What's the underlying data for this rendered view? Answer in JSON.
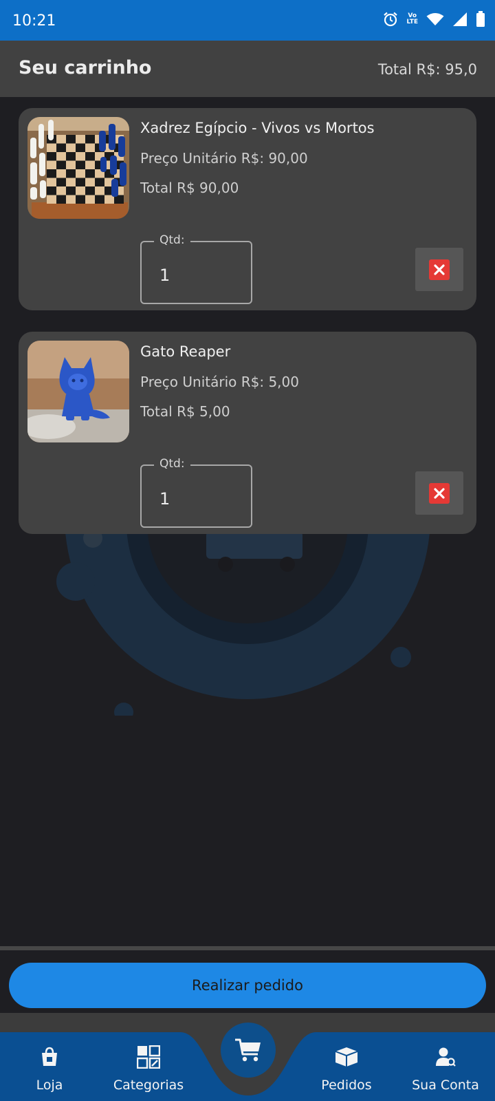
{
  "status_bar": {
    "time": "10:21",
    "network_label_top": "Vo",
    "network_label_bottom": "LTE"
  },
  "header": {
    "title": "Seu carrinho",
    "total": "Total R$: 95,0"
  },
  "cart": {
    "items": [
      {
        "name": "Xadrez Egípcio - Vivos vs Mortos",
        "unit_price": "Preço Unitário R$: 90,00",
        "total": "Total R$ 90,00",
        "qty_label": "Qtd:",
        "qty_value": "1",
        "image": "chess-set-photo"
      },
      {
        "name": "Gato Reaper",
        "unit_price": "Preço Unitário R$: 5,00",
        "total": "Total R$ 5,00",
        "qty_label": "Qtd:",
        "qty_value": "1",
        "image": "blue-cat-figurine-photo"
      }
    ]
  },
  "checkout": {
    "button_label": "Realizar pedido"
  },
  "bottom_nav": {
    "items": [
      {
        "label": "Loja",
        "icon": "store-bag-icon"
      },
      {
        "label": "Categorias",
        "icon": "categories-grid-icon"
      },
      {
        "label": "Pedidos",
        "icon": "package-icon"
      },
      {
        "label": "Sua Conta",
        "icon": "account-icon"
      }
    ],
    "center_icon": "cart-icon"
  },
  "colors": {
    "status_bar": "#0d6fc7",
    "primary_button": "#1e88e5",
    "nav_background": "#0a4f92",
    "remove_icon": "#e53935",
    "card": "#424242",
    "background": "#1e1e22"
  }
}
